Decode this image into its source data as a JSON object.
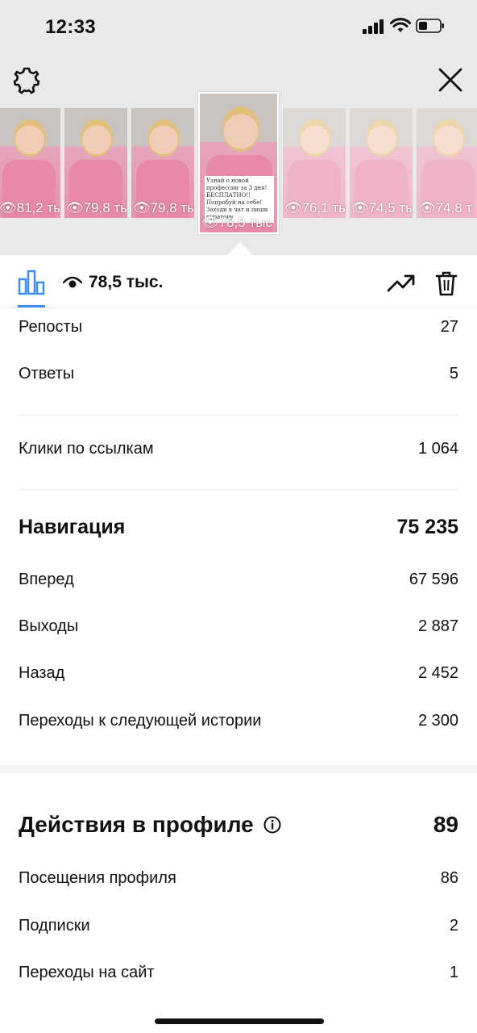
{
  "status_bar": {
    "time": "12:33"
  },
  "stories": [
    {
      "views": "81,2 ты"
    },
    {
      "views": "79,8 ты"
    },
    {
      "views": "79,8 тыс"
    },
    {
      "views": "78,5 тыс",
      "selected": true,
      "caption": "Узнай о новой профессии за 3 дня! БЕСПЛАТНО!! Попробуй на себе! Заходи в чат и пиши куратору"
    },
    {
      "views": "76,1 ты"
    },
    {
      "views": "74,5 ты"
    },
    {
      "views": "74,8 т"
    }
  ],
  "header": {
    "total_views": "78,5 тыс."
  },
  "interactions": [
    {
      "label": "Репосты",
      "value": "27"
    },
    {
      "label": "Ответы",
      "value": "5"
    }
  ],
  "link_clicks": {
    "label": "Клики по ссылкам",
    "value": "1 064"
  },
  "navigation": {
    "title": "Навигация",
    "total": "75 235",
    "items": [
      {
        "label": "Вперед",
        "value": "67 596"
      },
      {
        "label": "Выходы",
        "value": "2 887"
      },
      {
        "label": "Назад",
        "value": "2 452"
      },
      {
        "label": "Переходы к следующей истории",
        "value": "2 300"
      }
    ]
  },
  "profile_actions": {
    "title": "Действия в профиле",
    "total": "89",
    "items": [
      {
        "label": "Посещения профиля",
        "value": "86"
      },
      {
        "label": "Подписки",
        "value": "2"
      },
      {
        "label": "Переходы на сайт",
        "value": "1"
      }
    ]
  },
  "colors": {
    "accent": "#3b8df0",
    "top_background": "#e9e9e9"
  }
}
